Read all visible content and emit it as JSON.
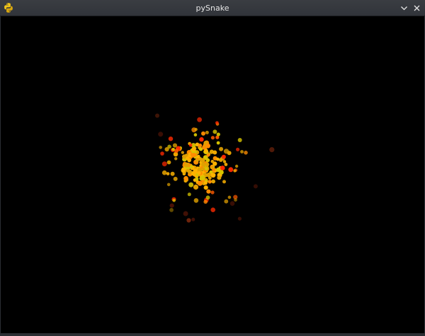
{
  "window": {
    "title": "pySnake",
    "app_icon": "python-icon",
    "controls": {
      "minimize_icon": "chevron-down-icon",
      "close_icon": "close-icon"
    }
  },
  "colors": {
    "titlebar": "#34373c",
    "title_text": "#e6e6e6",
    "canvas_background": "#000000",
    "particle_palette": [
      "#ff2a00",
      "#ff5a00",
      "#ff8c00",
      "#ffb300",
      "#d7c400",
      "#e0a000",
      "#b53a12",
      "#6b1a08",
      "#8a6a00"
    ]
  },
  "game": {
    "scene": "particle-burst"
  }
}
